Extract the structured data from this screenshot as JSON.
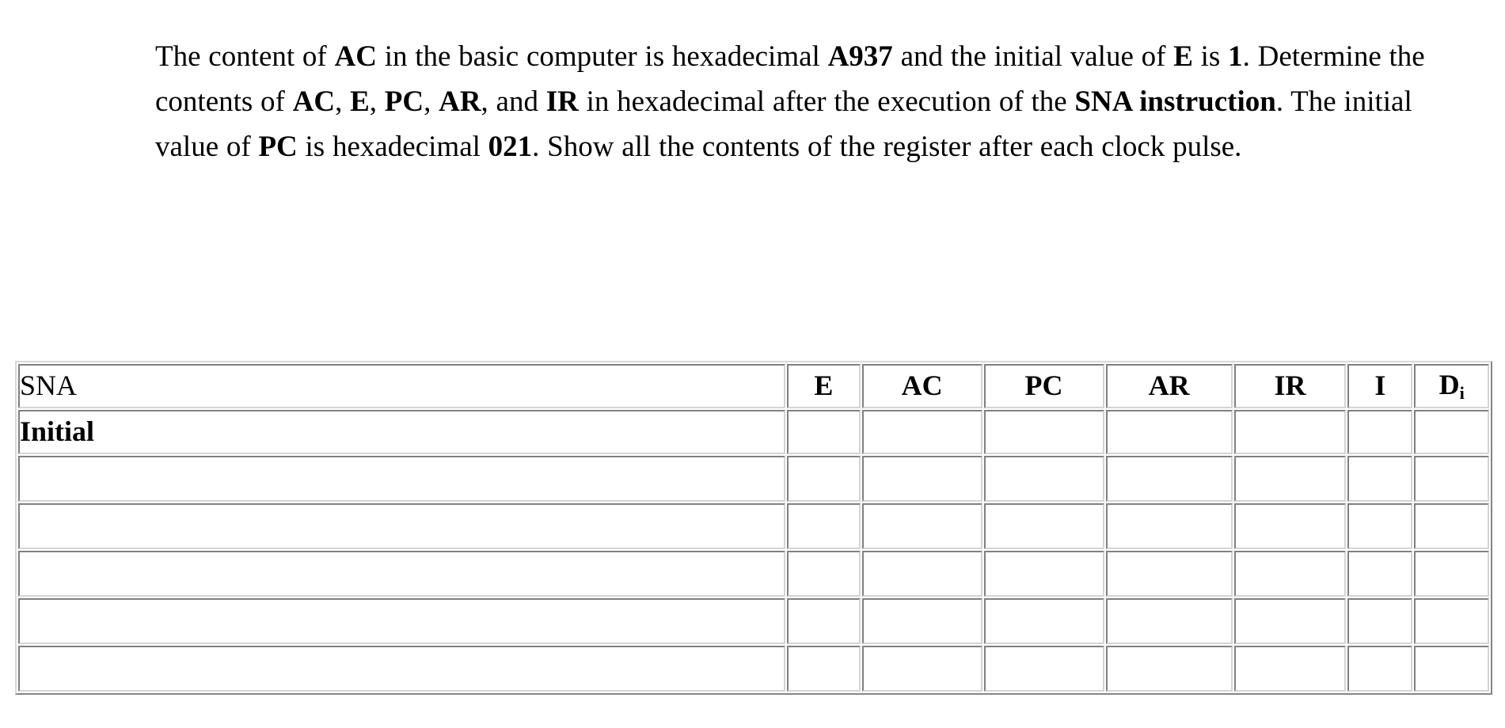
{
  "question": {
    "segments": [
      {
        "text": "The content of ",
        "bold": false
      },
      {
        "text": "AC",
        "bold": true
      },
      {
        "text": " in the basic computer is hexadecimal ",
        "bold": false
      },
      {
        "text": "A937",
        "bold": true
      },
      {
        "text": " and the initial value of ",
        "bold": false
      },
      {
        "text": "E",
        "bold": true
      },
      {
        "text": " is ",
        "bold": false
      },
      {
        "text": "1",
        "bold": true
      },
      {
        "text": ". Determine the contents of ",
        "bold": false
      },
      {
        "text": "AC",
        "bold": true
      },
      {
        "text": ", ",
        "bold": false
      },
      {
        "text": "E",
        "bold": true
      },
      {
        "text": ", ",
        "bold": false
      },
      {
        "text": "PC",
        "bold": true
      },
      {
        "text": ", ",
        "bold": false
      },
      {
        "text": "AR",
        "bold": true
      },
      {
        "text": ", and ",
        "bold": false
      },
      {
        "text": "IR",
        "bold": true
      },
      {
        "text": " in hexadecimal after the execution of the ",
        "bold": false
      },
      {
        "text": "SNA instruction",
        "bold": true
      },
      {
        "text": ". The initial value of ",
        "bold": false
      },
      {
        "text": "PC",
        "bold": true
      },
      {
        "text": " is hexadecimal ",
        "bold": false
      },
      {
        "text": "021",
        "bold": true
      },
      {
        "text": ". Show all the contents of the register after each clock pulse.",
        "bold": false
      }
    ],
    "plain": "The content of AC in the basic computer is hexadecimal A937 and the initial value of E is 1. Determine the contents of AC, E, PC, AR, and IR in hexadecimal after the execution of the SNA instruction. The initial value of PC is hexadecimal 021. Show all the contents of the register after each clock pulse."
  },
  "table": {
    "columns": [
      {
        "key": "instruction",
        "label": "SNA"
      },
      {
        "key": "e",
        "label": "E"
      },
      {
        "key": "ac",
        "label": "AC"
      },
      {
        "key": "pc",
        "label": "PC"
      },
      {
        "key": "ar",
        "label": "AR"
      },
      {
        "key": "ir",
        "label": "IR"
      },
      {
        "key": "i",
        "label": "I"
      },
      {
        "key": "d",
        "label": "D",
        "subscript": "i"
      }
    ],
    "rows": [
      {
        "label": "Initial",
        "e": "",
        "ac": "",
        "pc": "",
        "ar": "",
        "ir": "",
        "i": "",
        "d": ""
      },
      {
        "label": "",
        "e": "",
        "ac": "",
        "pc": "",
        "ar": "",
        "ir": "",
        "i": "",
        "d": ""
      },
      {
        "label": "",
        "e": "",
        "ac": "",
        "pc": "",
        "ar": "",
        "ir": "",
        "i": "",
        "d": ""
      },
      {
        "label": "",
        "e": "",
        "ac": "",
        "pc": "",
        "ar": "",
        "ir": "",
        "i": "",
        "d": ""
      },
      {
        "label": "",
        "e": "",
        "ac": "",
        "pc": "",
        "ar": "",
        "ir": "",
        "i": "",
        "d": ""
      },
      {
        "label": "",
        "e": "",
        "ac": "",
        "pc": "",
        "ar": "",
        "ir": "",
        "i": "",
        "d": ""
      }
    ]
  },
  "colors": {
    "page_background": "#ffffff",
    "text": "#000000",
    "table_border_light": "#e8e8e8",
    "table_border_shadow": "#999999"
  }
}
